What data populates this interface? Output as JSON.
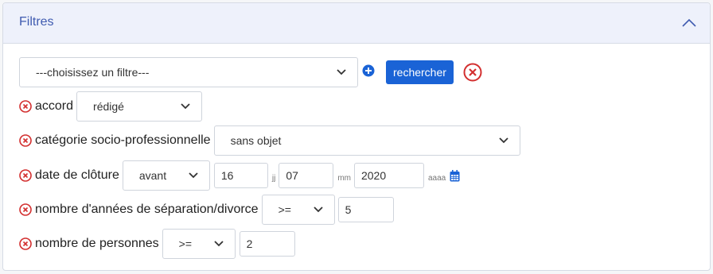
{
  "panel": {
    "title": "Filtres"
  },
  "filter_bar": {
    "select_value": "---choisissez un filtre---",
    "search_label": "rechercher"
  },
  "filters": {
    "accord": {
      "label": "accord",
      "value": "rédigé"
    },
    "categorie": {
      "label": "catégorie socio-professionnelle",
      "value": "sans objet"
    },
    "date_cloture": {
      "label": "date de clôture",
      "operator": "avant",
      "day": "16",
      "day_unit": "jj",
      "month": "07",
      "month_unit": "mm",
      "year": "2020",
      "year_unit": "aaaa"
    },
    "annees_separation": {
      "label": "nombre d'années de séparation/divorce",
      "operator": ">=",
      "value": "5"
    },
    "nb_personnes": {
      "label": "nombre de personnes",
      "operator": ">=",
      "value": "2"
    }
  },
  "colors": {
    "accent": "#1a63d6",
    "remove": "#d32f2f",
    "header_bg": "#eef1fb",
    "title": "#3f5bb0"
  }
}
